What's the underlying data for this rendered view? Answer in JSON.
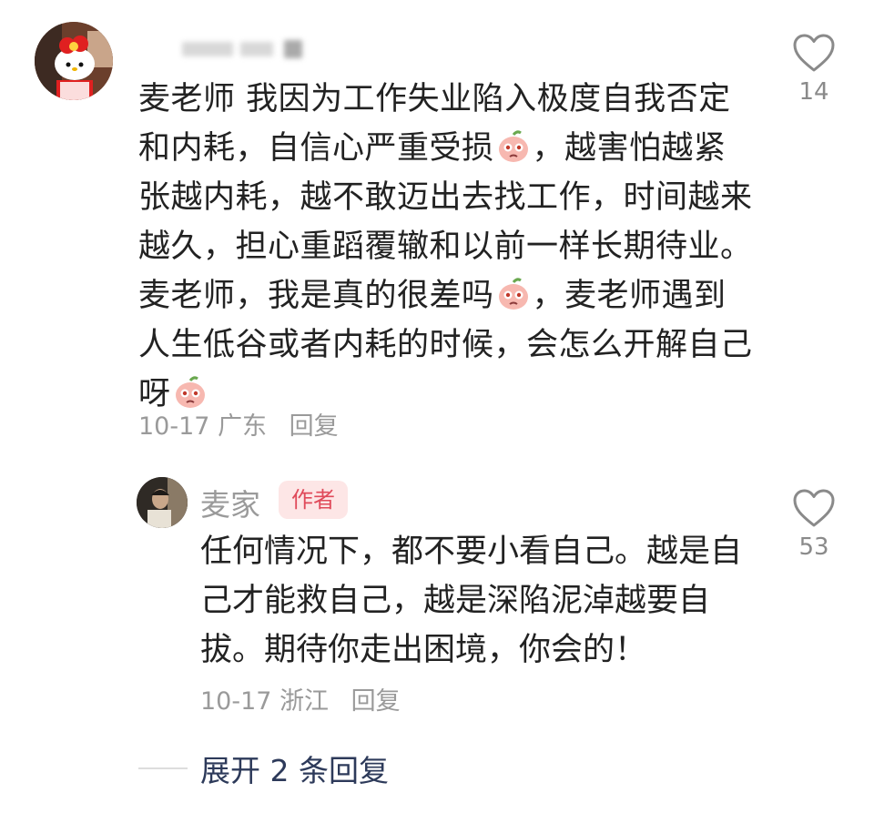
{
  "comment": {
    "text_parts": [
      "麦老师 我因为工作失业陷入极度自我否定和内耗，自信心严重受损",
      "，越害怕越紧张越内耗，越不敢迈出去找工作，时间越来越久，担心重蹈覆辙和以前一样长期待业。麦老师，我是真的很差吗",
      "，麦老师遇到人生低谷或者内耗的时候，会怎么开解自己呀"
    ],
    "emoji_icon": "crying-peach-icon",
    "date": "10-17",
    "location": "广东",
    "reply_label": "回复",
    "like_count": "14"
  },
  "reply": {
    "author_name": "麦家",
    "author_badge": "作者",
    "text": "任何情况下，都不要小看自己。越是自己才能救自己，越是深陷泥淖越要自拔。期待你走出困境，你会的！",
    "date": "10-17",
    "location": "浙江",
    "reply_label": "回复",
    "like_count": "53"
  },
  "expand_replies_label": "展开 2 条回复",
  "colors": {
    "text": "#222222",
    "meta": "#9a9a9a",
    "badge_bg": "#fde6e6",
    "badge_text": "#e04a5a",
    "expand_text": "#2d3a5a"
  }
}
